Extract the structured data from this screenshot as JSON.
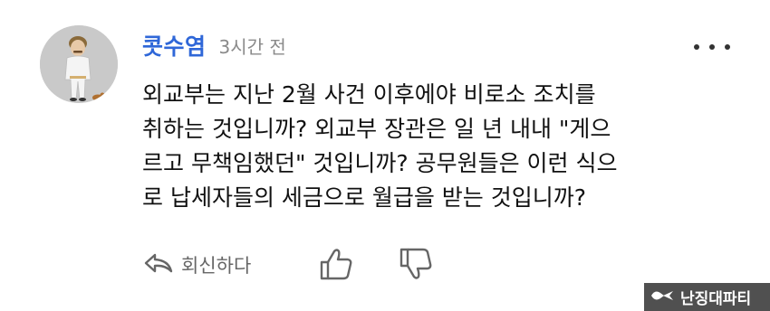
{
  "comment": {
    "username": "콧수염",
    "timestamp": "3시간 전",
    "lines": [
      "외교부는 지난 2월 사건 이후에야 비로소 조치를",
      "취하는 것입니까? 외교부 장관은 일 년 내내 \"게으",
      "르고 무책임했던\" 것입니까? 공무원들은 이런 식으",
      "로 납세자들의 세금으로 월급을 받는 것입니까?"
    ]
  },
  "actions": {
    "reply_label": "회신하다"
  },
  "watermark": {
    "text": "난징대파티"
  },
  "colors": {
    "username": "#2f67d8",
    "timestamp": "#8a8a8a",
    "icon": "#666666"
  }
}
